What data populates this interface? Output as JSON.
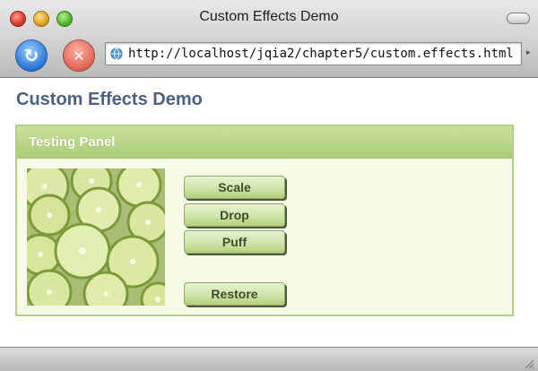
{
  "window": {
    "title": "Custom Effects Demo"
  },
  "toolbar": {
    "url": "http://localhost/jqia2/chapter5/custom.effects.html",
    "back_icon": "back-arrow-icon",
    "stop_icon": "stop-x-icon"
  },
  "page": {
    "title": "Custom Effects Demo",
    "panel": {
      "header": "Testing Panel",
      "image": "limes-photo",
      "buttons": {
        "scale": "Scale",
        "drop": "Drop",
        "puff": "Puff",
        "restore": "Restore"
      }
    }
  },
  "colors": {
    "page_title": "#4d6182",
    "panel_header": "#aacd76",
    "panel_border": "#b3d088",
    "panel_body": "#f5fbe7",
    "button": "#cfe5a9"
  }
}
